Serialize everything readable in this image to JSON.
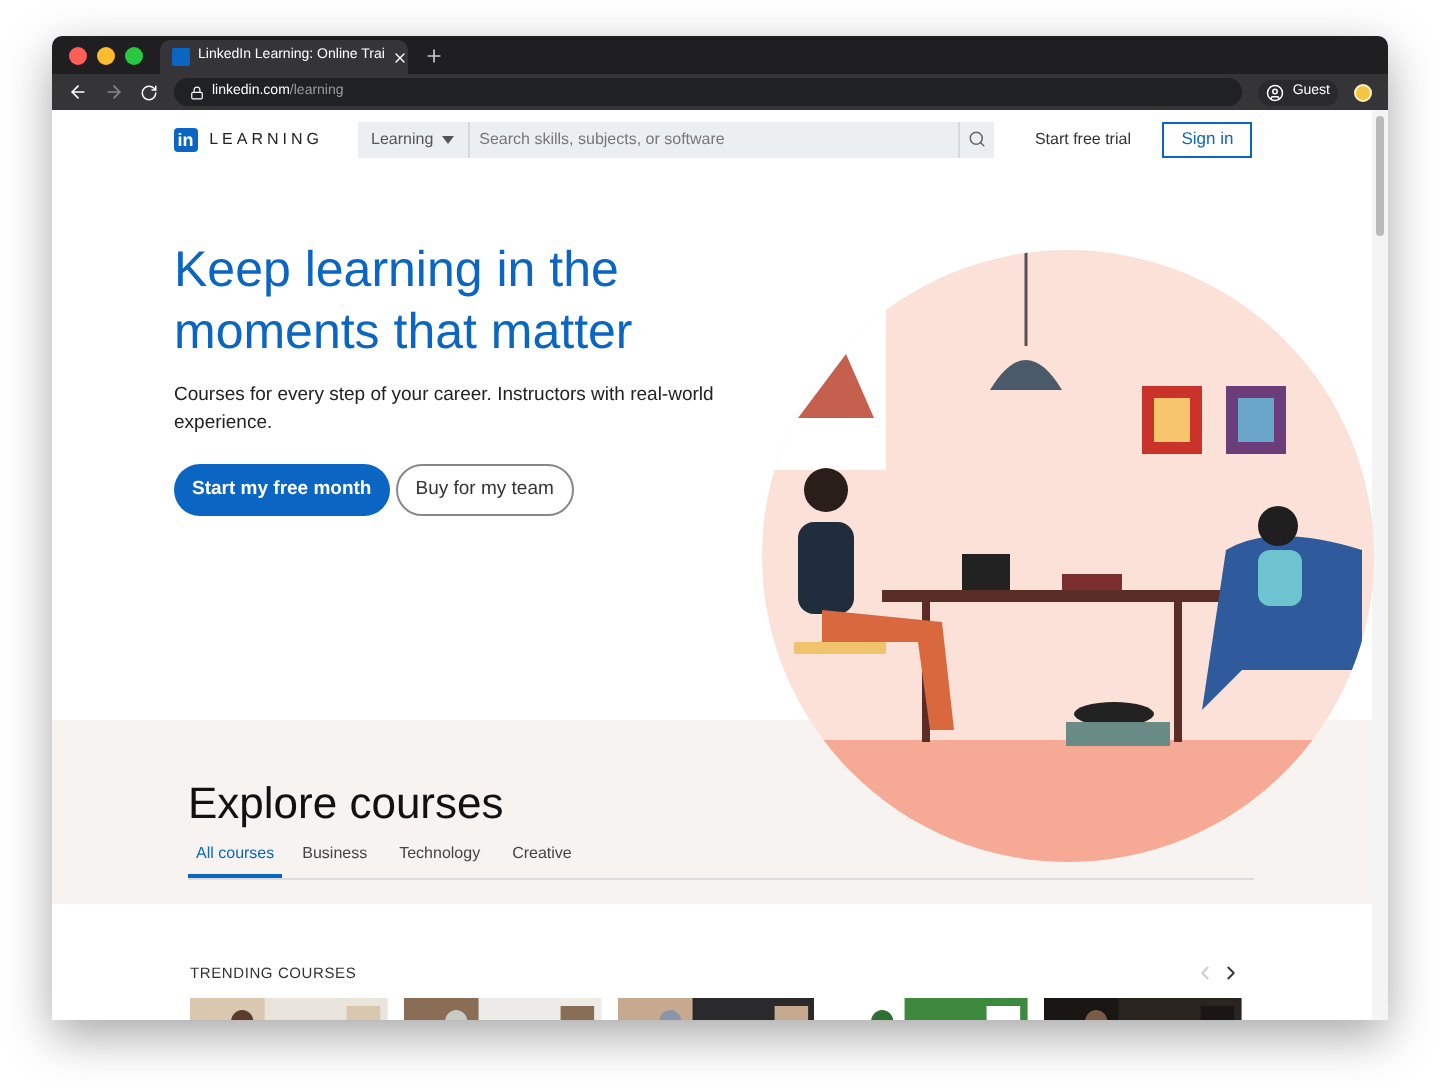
{
  "browser": {
    "tab_title": "LinkedIn Learning: Online Trai",
    "url_host": "linkedin.com",
    "url_path": "/learning",
    "profile": "Guest"
  },
  "header": {
    "logo_mark": "in",
    "logo_text": "LEARNING",
    "search_scope": "Learning",
    "search": {
      "placeholder": "Search skills, subjects, or software"
    },
    "trial_link": "Start free trial",
    "sign_in": "Sign in"
  },
  "hero": {
    "title_lines": [
      "Keep learning in the",
      "moments that matter"
    ],
    "description": "Courses for every step of your career. Instructors with real-world experience.",
    "buttons": [
      {
        "label": "Start my free month",
        "kind": "primary"
      },
      {
        "label": "Buy for my team",
        "kind": "secondary"
      }
    ]
  },
  "explore": {
    "title": "Explore courses",
    "tabs": [
      {
        "label": "All courses",
        "selected": true
      },
      {
        "label": "Business",
        "selected": false
      },
      {
        "label": "Technology",
        "selected": false
      },
      {
        "label": "Creative",
        "selected": false
      }
    ]
  },
  "trending": {
    "title": "TRENDING COURSES",
    "prev_disabled": true
  }
}
